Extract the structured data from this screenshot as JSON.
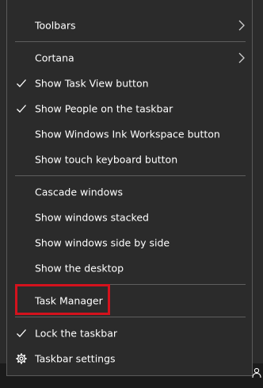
{
  "menu": {
    "toolbars": "Toolbars",
    "cortana": "Cortana",
    "show_task_view": "Show Task View button",
    "show_people": "Show People on the taskbar",
    "show_ink_workspace": "Show Windows Ink Workspace button",
    "show_touch_keyboard": "Show touch keyboard button",
    "cascade_windows": "Cascade windows",
    "show_stacked": "Show windows stacked",
    "show_side_by_side": "Show windows side by side",
    "show_desktop": "Show the desktop",
    "task_manager": "Task Manager",
    "lock_taskbar": "Lock the taskbar",
    "taskbar_settings": "Taskbar settings"
  },
  "icons": {
    "check": "check-icon",
    "chevron": "chevron-right-icon",
    "gear": "gear-icon",
    "people": "people-icon"
  },
  "colors": {
    "menu_background": "#2b2b2b",
    "text": "#ffffff",
    "separator": "#5e5e5e",
    "highlight": "#d4121d"
  }
}
